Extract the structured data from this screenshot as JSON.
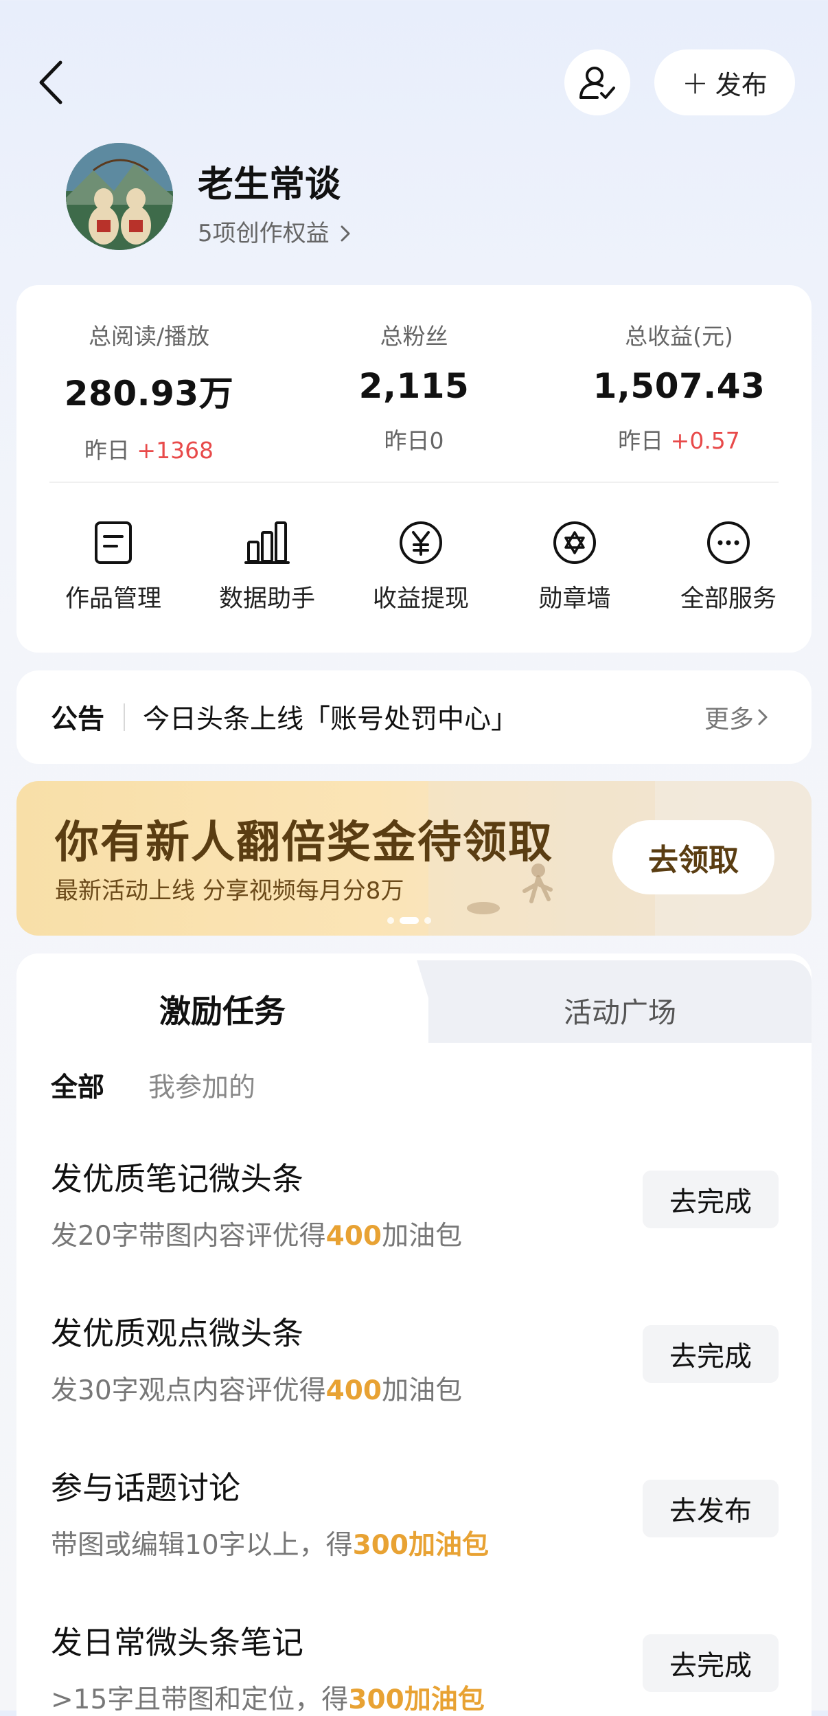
{
  "header": {
    "publish_label": "发布"
  },
  "profile": {
    "name": "老生常谈",
    "rights": "5项创作权益"
  },
  "stats": [
    {
      "label": "总阅读/播放",
      "value": "280.93万",
      "delta_prefix": "昨日",
      "delta": "+1368",
      "delta_positive": true
    },
    {
      "label": "总粉丝",
      "value": "2,115",
      "delta_prefix": "昨日",
      "delta": "0",
      "delta_positive": false
    },
    {
      "label": "总收益(元)",
      "value": "1,507.43",
      "delta_prefix": "昨日",
      "delta": "+0.57",
      "delta_positive": true
    }
  ],
  "tools": [
    {
      "label": "作品管理",
      "icon": "document-icon"
    },
    {
      "label": "数据助手",
      "icon": "bar-chart-icon"
    },
    {
      "label": "收益提现",
      "icon": "yuan-icon"
    },
    {
      "label": "勋章墙",
      "icon": "medal-icon"
    },
    {
      "label": "全部服务",
      "icon": "more-icon"
    }
  ],
  "notice": {
    "tag": "公告",
    "text": "今日头条上线「账号处罚中心」",
    "more": "更多"
  },
  "banner": {
    "title": "你有新人翻倍奖金待领取",
    "subtitle": "最新活动上线 分享视频每月分8万",
    "button": "去领取"
  },
  "tabs": {
    "active": "激励任务",
    "inactive": "活动广场"
  },
  "filters": {
    "all": "全部",
    "mine": "我参加的"
  },
  "tasks": [
    {
      "name": "发优质笔记微头条",
      "desc_pre": "发20字带图内容评优得",
      "highlight": "400",
      "desc_post": "加油包",
      "button": "去完成"
    },
    {
      "name": "发优质观点微头条",
      "desc_pre": "发30字观点内容评优得",
      "highlight": "400",
      "desc_post": "加油包",
      "button": "去完成"
    },
    {
      "name": "参与话题讨论",
      "desc_pre": "带图或编辑10字以上，得",
      "highlight": "300加油包",
      "desc_post": "",
      "button": "去发布"
    },
    {
      "name": "发日常微头条笔记",
      "desc_pre": ">15字且带图和定位，得",
      "highlight": "300加油包",
      "desc_post": "",
      "button": "去完成"
    }
  ],
  "colors": {
    "positive": "#e84a4a",
    "highlight": "#e8a233",
    "banner_text": "#5a3d12"
  }
}
